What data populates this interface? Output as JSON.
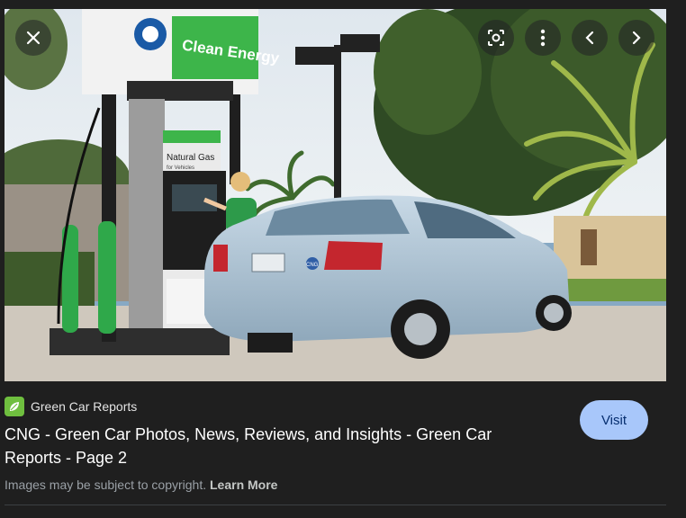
{
  "image": {
    "alt": "Woman fueling a silver sedan at a Clean Energy natural gas station",
    "sign_text": "Clean Energy",
    "pump_label_line1": "Natural Gas",
    "pump_label_line2": "for Vehicles",
    "cng_badge": "CNG"
  },
  "controls": {
    "close": "close-icon",
    "lens": "lens-icon",
    "more": "more-vert-icon",
    "prev": "chevron-left-icon",
    "next": "chevron-right-icon"
  },
  "result": {
    "source_name": "Green Car Reports",
    "title": "CNG - Green Car Photos, News, Reviews, and Insights - Green Car Reports - Page 2",
    "visit_label": "Visit",
    "copyright_text": "Images may be subject to copyright.",
    "learn_more": "Learn More"
  },
  "colors": {
    "background": "#1f1f1f",
    "visit_button": "#a8c7fa",
    "clean_energy_green": "#3db54a"
  }
}
